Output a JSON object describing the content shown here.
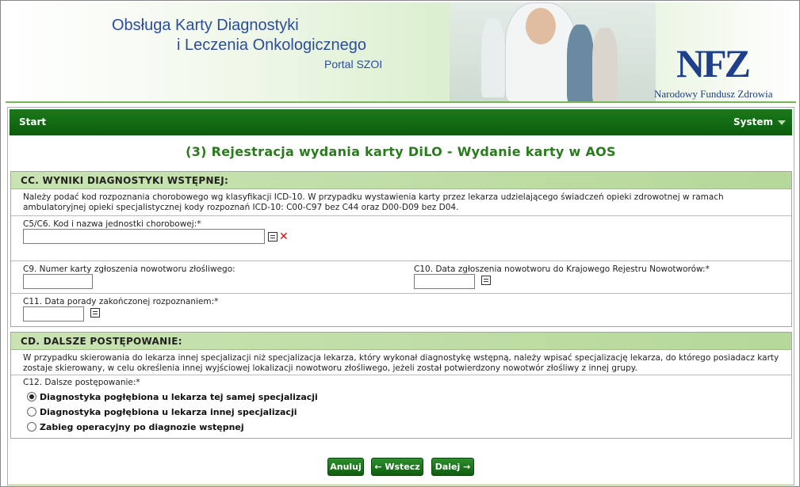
{
  "banner": {
    "title_line1": "Obsługa Karty Diagnostyki",
    "title_line2": "i Leczenia Onkologicznego",
    "portal": "Portal SZOI",
    "logo": "NFZ",
    "logo_subtitle": "Narodowy Fundusz Zdrowia"
  },
  "nav": {
    "start": "Start",
    "system": "System"
  },
  "page_title": "(3) Rejestracja wydania karty DiLO - Wydanie karty w AOS",
  "section_cc": {
    "heading": "CC. WYNIKI DIAGNOSTYKI WSTĘPNEJ:",
    "note": "Należy podać kod rozpoznania chorobowego wg klasyfikacji ICD-10. W przypadku wystawienia karty przez lekarza udzielającego świadczeń opieki zdrowotnej w ramach ambulatoryjnej opieki specjalistycznej kody rozpoznań ICD-10: C00-C97 bez C44 oraz D00-D09 bez D04.",
    "c5_label": "C5/C6. Kod i nazwa jednostki chorobowej:*",
    "c5_value": "",
    "c9_label": "C9. Numer karty zgłoszenia nowotworu złośliwego:",
    "c9_value": "",
    "c10_label": "C10. Data zgłoszenia nowotworu do Krajowego Rejestru Nowotworów:*",
    "c10_value": "",
    "c11_label": "C11. Data porady zakończonej rozpoznaniem:*",
    "c11_value": ""
  },
  "section_cd": {
    "heading": "CD. DALSZE POSTĘPOWANIE:",
    "note": "W przypadku skierowania do lekarza innej specjalizacji niż specjalizacja lekarza, który wykonał diagnostykę wstępną, należy wpisać specjalizację lekarza, do którego posiadacz karty zostaje skierowany, w celu określenia innej wyjściowej lokalizacji nowotworu złośliwego, jeżeli został potwierdzony nowotwór złośliwy z innej grupy.",
    "c12_label": "C12. Dalsze postępowanie:*",
    "options": [
      {
        "label": "Diagnostyka pogłębiona u lekarza tej samej specjalizacji",
        "selected": true
      },
      {
        "label": "Diagnostyka pogłębiona u lekarza innej specjalizacji",
        "selected": false
      },
      {
        "label": "Zabieg operacyjny po diagnozie wstępnej",
        "selected": false
      }
    ]
  },
  "buttons": {
    "cancel": "Anuluj",
    "back": "← Wstecz",
    "next": "Dalej →"
  },
  "colors": {
    "nav_green": "#0c5c0c",
    "title_green": "#2a7a1e",
    "section_head": "#c9e3b2",
    "banner_blue": "#2c4d9a",
    "delete_red": "#c21414"
  },
  "icons": {
    "list": "list-icon",
    "delete": "delete-icon",
    "dropdown": "caret-down-icon"
  }
}
